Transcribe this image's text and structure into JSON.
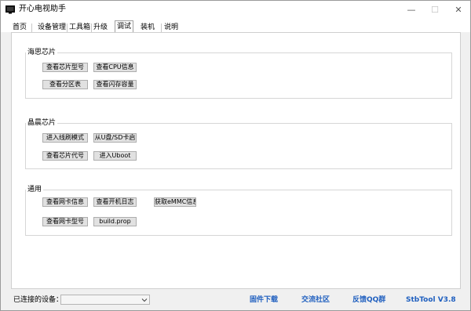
{
  "window": {
    "title": "开心电视助手",
    "minimize_glyph": "—",
    "maximize_glyph": "☐",
    "close_glyph": "✕"
  },
  "tabs": [
    {
      "label": "首页",
      "active": false
    },
    {
      "label": "设备管理",
      "active": false
    },
    {
      "label": "工具箱",
      "active": false
    },
    {
      "label": "升级",
      "active": false
    },
    {
      "label": "调试",
      "active": true
    },
    {
      "label": "装机",
      "active": false
    },
    {
      "label": "说明",
      "active": false
    }
  ],
  "groups": {
    "hisi": {
      "title": "海思芯片",
      "buttons": [
        "查看芯片型号",
        "查看CPU信息",
        "查看分区表",
        "查看闪存容量"
      ]
    },
    "amlogic": {
      "title": "晶晨芯片",
      "buttons": [
        "进入线刷模式",
        "从U盘/SD卡启",
        "查看芯片代号",
        "进入Uboot"
      ]
    },
    "general": {
      "title": "通用",
      "buttons": [
        "查看网卡信息",
        "查看开机日志",
        "获取eMMC信息",
        "查看网卡型号",
        "build.prop"
      ]
    }
  },
  "status": {
    "connected_label": "已连接的设备：",
    "device_value": "",
    "links": [
      "固件下载",
      "交流社区",
      "反馈QQ群",
      "StbTool V3.8"
    ]
  },
  "colors": {
    "link": "#1f5fbf",
    "button_face": "#e1e1e1",
    "window_bg": "#f0f0f0"
  }
}
